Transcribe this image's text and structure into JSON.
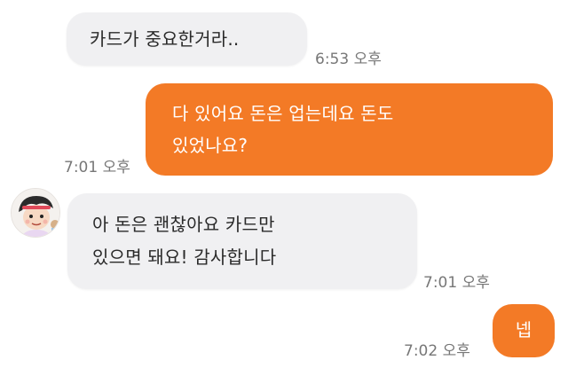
{
  "messages": [
    {
      "direction": "incoming",
      "text": "카드가 중요한거라..",
      "time": "6:53 오후"
    },
    {
      "direction": "outgoing",
      "text": "다 있어요 돈은 업는데요  돈도\n있었나요?",
      "time": "7:01 오후"
    },
    {
      "direction": "incoming",
      "text": "아 돈은 괜찮아요 카드만\n있으면 돼요! 감사합니다",
      "time": "7:01 오후"
    },
    {
      "direction": "outgoing",
      "text": "넵",
      "time": "7:02 오후"
    }
  ],
  "colors": {
    "outgoing_bubble": "#f37a26",
    "incoming_bubble": "#f0f0f2",
    "timestamp": "#777777"
  },
  "icons": {
    "avatar": "cartoon-character-avatar"
  }
}
